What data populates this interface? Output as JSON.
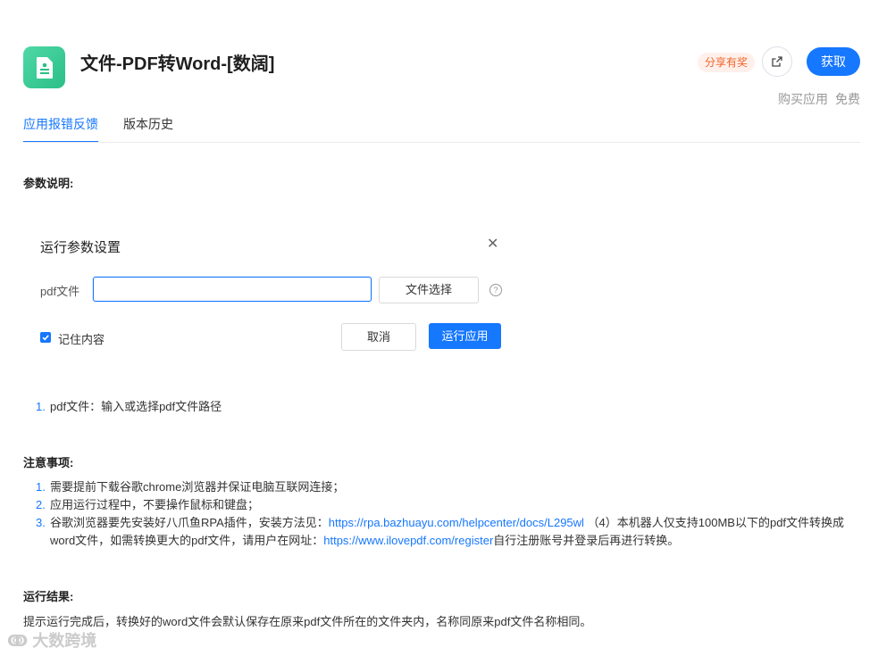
{
  "header": {
    "app_title": "文件-PDF转Word-[数阔]",
    "app_icon": "document-icon",
    "share_badge": "分享有奖",
    "share_icon": "external-link-icon",
    "get_button": "获取",
    "purchase_label": "购买应用",
    "purchase_price": "免费"
  },
  "tabs": [
    {
      "label": "应用报错反馈",
      "active": true
    },
    {
      "label": "版本历史",
      "active": false
    }
  ],
  "params_section_title": "参数说明:",
  "dialog": {
    "title": "运行参数设置",
    "close_icon": "close-icon",
    "field_label": "pdf文件",
    "field_value": "",
    "file_select_button": "文件选择",
    "help_icon": "question-circle-icon",
    "remember_checked": true,
    "remember_label": "记住内容",
    "cancel_button": "取消",
    "run_button": "运行应用"
  },
  "params_list": [
    {
      "num": "1.",
      "text": "pdf文件：输入或选择pdf文件路径"
    }
  ],
  "notes": {
    "title": "注意事项:",
    "items": [
      {
        "num": "1.",
        "text": "需要提前下载谷歌chrome浏览器并保证电脑互联网连接；"
      },
      {
        "num": "2.",
        "text": "应用运行过程中，不要操作鼠标和键盘；"
      },
      {
        "num": "3.",
        "text_a": "谷歌浏览器要先安装好八爪鱼RPA插件，安装方法见：",
        "link_a": "https://rpa.bazhuayu.com/helpcenter/docs/L295wl",
        "text_b": " （4）本机器人仅支持100MB以下的pdf文件转换成word文件，如需转换更大的pdf文件，请用户在网址：",
        "link_b": "https://www.ilovepdf.com/register",
        "text_c": "自行注册账号并登录后再进行转换。"
      }
    ]
  },
  "result": {
    "title": "运行结果:",
    "text": "提示运行完成后，转换好的word文件会默认保存在原来pdf文件所在的文件夹内，名称同原来pdf文件名称相同。"
  },
  "watermark": "大数跨境",
  "colors": {
    "accent": "#1677ff",
    "icon_green": "#2bbf86",
    "badge_orange": "#f0642a"
  }
}
